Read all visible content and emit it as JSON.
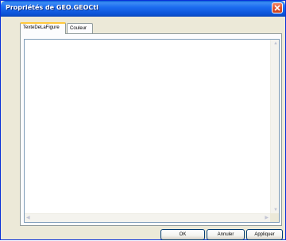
{
  "window": {
    "title": "Propriétés de GEO.GEOCtl"
  },
  "tabs": [
    {
      "label": "TexteDeLaFigure",
      "active": true
    },
    {
      "label": "Couleur",
      "active": false
    }
  ],
  "textarea": {
    "value": ""
  },
  "buttons": {
    "ok": "OK",
    "cancel": "Annuler",
    "apply": "Appliquer"
  },
  "colors": {
    "titlebar": "#0b52d6",
    "window_bg": "#ece9d8",
    "close": "#e0522e",
    "tab_highlight": "#ffc83c"
  },
  "icons": {
    "close": "close-icon",
    "scroll_up": "arrow-up-icon",
    "scroll_down": "arrow-down-icon",
    "scroll_left": "arrow-left-icon",
    "scroll_right": "arrow-right-icon"
  }
}
